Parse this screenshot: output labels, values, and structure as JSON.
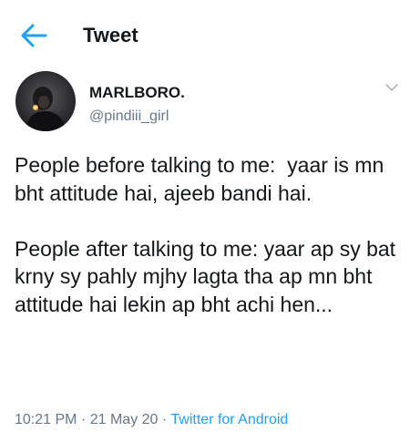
{
  "header": {
    "title": "Tweet",
    "back_icon": "back-arrow-icon"
  },
  "author": {
    "display_name": "MARLBORO.",
    "handle": "@pindiii_girl",
    "menu_icon": "chevron-down-icon"
  },
  "tweet": {
    "paragraphs": [
      "People before talking to me:  yaar is mn bht attitude hai, ajeeb bandi hai.",
      "People after talking to me: yaar ap sy bat krny sy pahly mjhy lagta tha ap mn bht attitude hai lekin ap bht achi hen..."
    ]
  },
  "meta": {
    "time": "10:21 PM",
    "separator": "·",
    "date": "21 May 20",
    "source": "Twitter for Android"
  },
  "colors": {
    "accent": "#1da1f2",
    "text": "#14171a",
    "muted": "#657786"
  }
}
